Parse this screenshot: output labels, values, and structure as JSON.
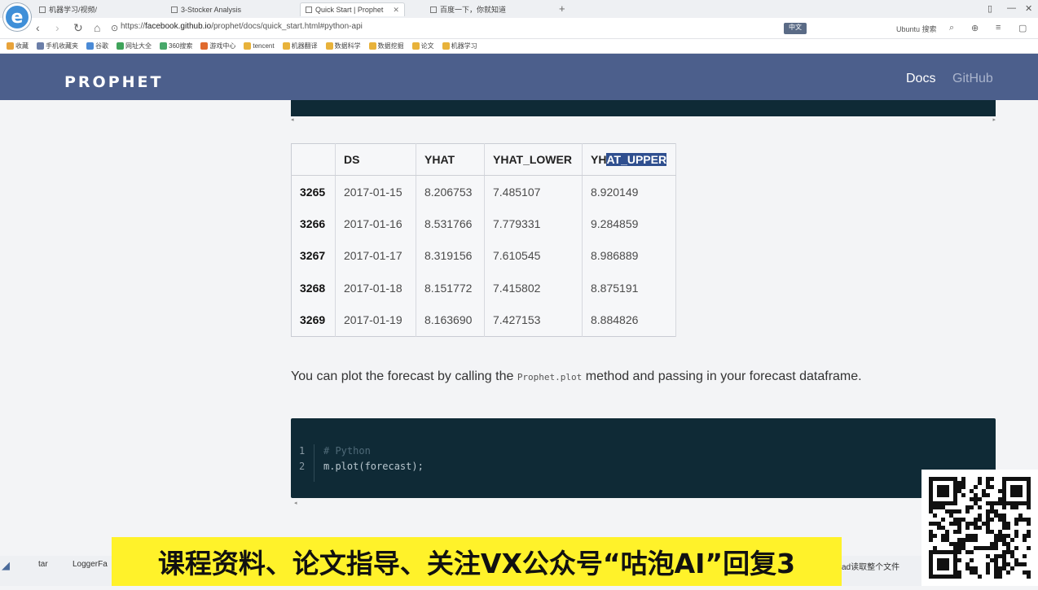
{
  "browser": {
    "tabs": [
      {
        "label": "机器学习/视频/"
      },
      {
        "label": "3-Stocker Analysis"
      },
      {
        "label": "Quick Start | Prophet"
      },
      {
        "label": "百度一下，你就知道"
      }
    ],
    "new_tab": "+",
    "url_prefix": "https://",
    "url_domain": "facebook.github.io",
    "url_path": "/prophet/docs/quick_start.html#python-api",
    "url_right_button": "中文",
    "url_right_text": "Ubuntu 搜索",
    "bookmarks": [
      {
        "label": "收藏",
        "color": "#e8a33a"
      },
      {
        "label": "手机收藏夹",
        "color": "#6b7ea8"
      },
      {
        "label": "谷歌",
        "color": "#4a8ad6"
      },
      {
        "label": "网址大全",
        "color": "#3fa35a"
      },
      {
        "label": "360搜索",
        "color": "#48a86a"
      },
      {
        "label": "游戏中心",
        "color": "#e06a2e"
      },
      {
        "label": "tencent",
        "color": "#e8b23a"
      },
      {
        "label": "机器翻译",
        "color": "#e8b23a"
      },
      {
        "label": "数据科学",
        "color": "#e8b23a"
      },
      {
        "label": "数据挖掘",
        "color": "#e8b23a"
      },
      {
        "label": "论文",
        "color": "#e8b23a"
      },
      {
        "label": "机器学习",
        "color": "#e8b23a"
      }
    ]
  },
  "site": {
    "logo": "PROPHET",
    "nav_docs": "Docs",
    "nav_github": "GitHub"
  },
  "table": {
    "columns": [
      "",
      "ds",
      "yhat",
      "yhat_lower",
      "yhat_upper"
    ],
    "highlight_prefix": "yh",
    "highlight_rest": "at_upper",
    "rows": [
      {
        "idx": "3265",
        "ds": "2017-01-15",
        "yhat": "8.206753",
        "lower": "7.485107",
        "upper": "8.920149"
      },
      {
        "idx": "3266",
        "ds": "2017-01-16",
        "yhat": "8.531766",
        "lower": "7.779331",
        "upper": "9.284859"
      },
      {
        "idx": "3267",
        "ds": "2017-01-17",
        "yhat": "8.319156",
        "lower": "7.610545",
        "upper": "8.986889"
      },
      {
        "idx": "3268",
        "ds": "2017-01-18",
        "yhat": "8.151772",
        "lower": "7.415802",
        "upper": "8.875191"
      },
      {
        "idx": "3269",
        "ds": "2017-01-19",
        "yhat": "8.163690",
        "lower": "7.427153",
        "upper": "8.884826"
      }
    ]
  },
  "paragraph": {
    "before": "You can plot the forecast by calling the ",
    "code": "Prophet.plot",
    "after": " method and passing in your forecast dataframe."
  },
  "code_block": {
    "lines": [
      {
        "num": "1",
        "text": "# Python",
        "kind": "comment"
      },
      {
        "num": "2",
        "text": "m.plot(forecast);",
        "kind": "code"
      }
    ]
  },
  "overlay": {
    "banner": "课程资料、论文指导、关注VX公众号“咕泡AI”回复3",
    "taskbar_left_1": "tar",
    "taskbar_left_2": "LoggerFa",
    "taskbar_right": "ad读取整个文件"
  }
}
